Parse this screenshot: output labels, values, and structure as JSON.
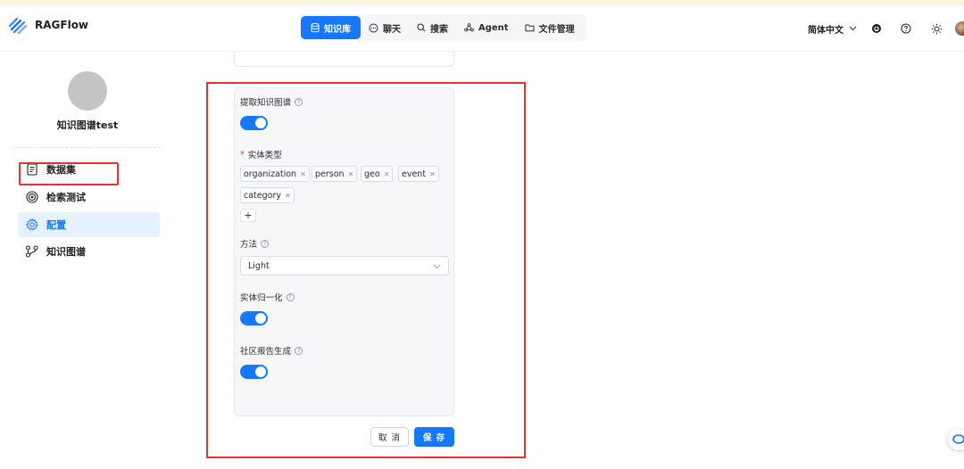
{
  "app": {
    "name": "RAGFlow"
  },
  "nav": {
    "items": [
      {
        "label": "知识库",
        "icon": "database-icon",
        "active": true
      },
      {
        "label": "聊天",
        "icon": "chat-icon",
        "active": false
      },
      {
        "label": "搜索",
        "icon": "search-icon",
        "active": false
      },
      {
        "label": "Agent",
        "icon": "agent-graph-icon",
        "active": false
      },
      {
        "label": "文件管理",
        "icon": "folder-icon",
        "active": false
      }
    ]
  },
  "header": {
    "language": "简体中文",
    "icons": [
      "github-icon",
      "help-icon",
      "theme-sun-icon",
      "user-avatar"
    ]
  },
  "sidebar": {
    "kb_name": "知识图谱test",
    "items": [
      {
        "label": "数据集",
        "icon": "document-icon",
        "active": false
      },
      {
        "label": "检索测试",
        "icon": "target-icon",
        "active": false
      },
      {
        "label": "配置",
        "icon": "gear-icon",
        "active": true
      },
      {
        "label": "知识图谱",
        "icon": "graph-icon",
        "active": false
      }
    ]
  },
  "form": {
    "extract_kg": {
      "label": "提取知识图谱",
      "enabled": true
    },
    "entity_types": {
      "label": "实体类型",
      "required": true,
      "tags": [
        "organization",
        "person",
        "geo",
        "event",
        "category"
      ],
      "add_label": "+"
    },
    "method": {
      "label": "方法",
      "value": "Light"
    },
    "entity_resolution": {
      "label": "实体归一化",
      "enabled": true
    },
    "community_report": {
      "label": "社区报告生成",
      "enabled": true
    }
  },
  "actions": {
    "cancel_label": "取 消",
    "save_label": "保 存"
  },
  "colors": {
    "primary": "#1677ff",
    "highlight_box": "#e8312c"
  }
}
